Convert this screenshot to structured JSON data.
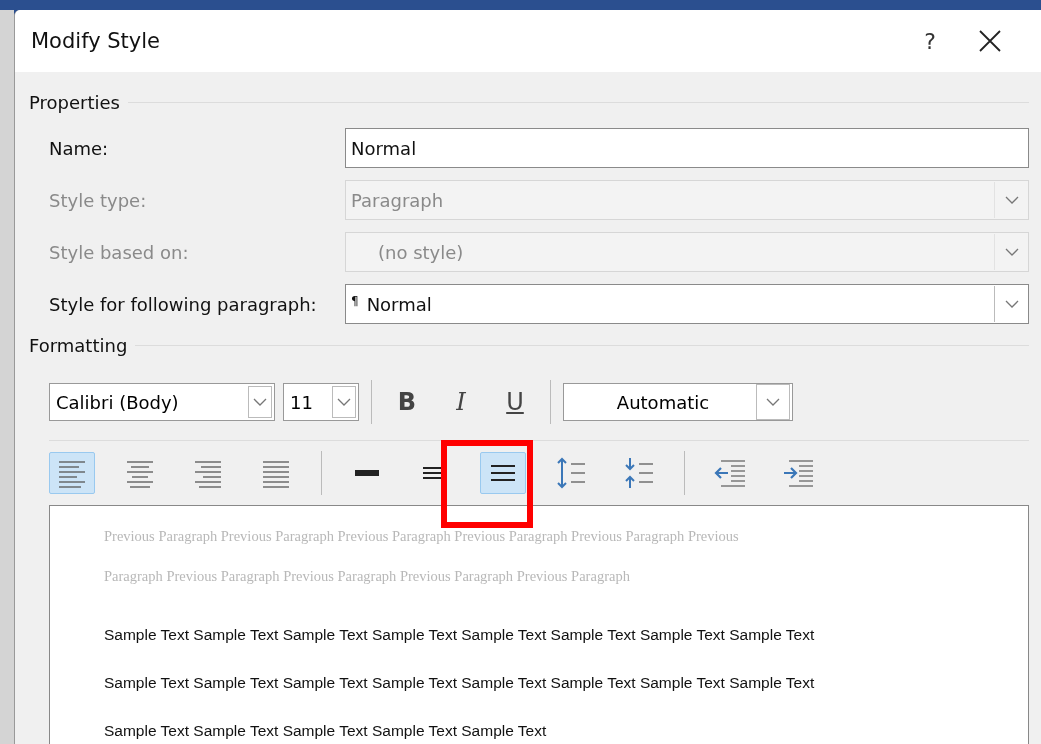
{
  "window": {
    "title": "Modify Style",
    "help": "?"
  },
  "properties": {
    "heading": "Properties",
    "rows": [
      {
        "label": "Name:",
        "kind": "text",
        "value": "Normal",
        "disabled": false
      },
      {
        "label": "Style type:",
        "kind": "select",
        "value": "Paragraph",
        "disabled": true
      },
      {
        "label": "Style based on:",
        "kind": "select",
        "value": "(no style)",
        "disabled": true
      },
      {
        "label": "Style for following paragraph:",
        "kind": "select",
        "value": "Normal",
        "mark": "¶",
        "disabled": false
      }
    ]
  },
  "formatting": {
    "heading": "Formatting",
    "font": "Calibri (Body)",
    "size": "11",
    "font_color": "Automatic",
    "styles": [
      {
        "label": "B",
        "kind": "bold",
        "selected": false
      },
      {
        "label": "I",
        "kind": "italic",
        "selected": false
      },
      {
        "label": "U",
        "kind": "underline",
        "selected": false
      }
    ],
    "paragraph_groups": [
      [
        {
          "kind": "align-left",
          "selected": true
        },
        {
          "kind": "align-center",
          "selected": false
        },
        {
          "kind": "align-right",
          "selected": false
        },
        {
          "kind": "justify",
          "selected": false
        }
      ],
      [
        {
          "kind": "single",
          "selected": false
        },
        {
          "kind": "one-half",
          "selected": false
        },
        {
          "kind": "double",
          "selected": true,
          "highlighted": true
        },
        {
          "kind": "space-up",
          "selected": false
        },
        {
          "kind": "space-down",
          "selected": false
        }
      ],
      [
        {
          "kind": "outdent",
          "selected": false
        },
        {
          "kind": "indent",
          "selected": false
        }
      ]
    ]
  },
  "preview": {
    "previous_lines": [
      "Previous Paragraph Previous Paragraph Previous Paragraph Previous Paragraph Previous Paragraph Previous",
      "Paragraph Previous Paragraph Previous Paragraph Previous Paragraph Previous Paragraph"
    ],
    "sample_lines": [
      "Sample Text Sample Text Sample Text Sample Text Sample Text Sample Text Sample Text Sample Text",
      "Sample Text Sample Text Sample Text Sample Text Sample Text Sample Text Sample Text Sample Text",
      "Sample Text Sample Text Sample Text Sample Text Sample Text"
    ]
  }
}
